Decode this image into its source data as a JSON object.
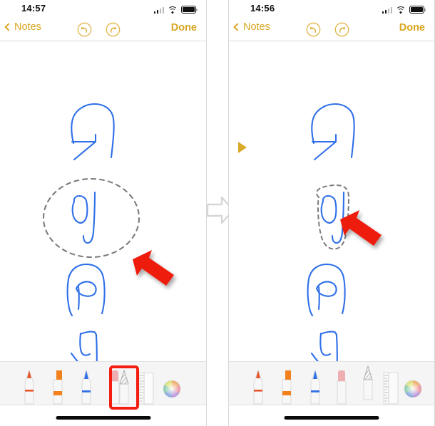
{
  "meta": {
    "app_name": "Notes",
    "screenshot_kind": "two-step-tutorial",
    "canvas_background": "#ffffff",
    "ink_color": "#2f6fe8",
    "accent_color": "#d9a520",
    "highlight_color": "#f41e10",
    "tray_background": "#f5f5f5"
  },
  "panels": [
    {
      "id": "before",
      "status_bar": {
        "time": "14:57",
        "icons": [
          "cellular-signal-icon",
          "wifi-icon",
          "battery-icon"
        ]
      },
      "nav_bar": {
        "back_label": "Notes",
        "back_icon": "chevron-left-icon",
        "undo_icon": "undo-circle-icon",
        "redo_icon": "redo-circle-icon",
        "done_label": "Done"
      },
      "canvas": {
        "selection": {
          "shape": "loose-circle",
          "style": "dashed",
          "color": "#808080",
          "label": "lasso-selection-loose"
        },
        "cursor": {
          "kind": "arrow-pointer",
          "color": "#ee1c11",
          "direction": "up-left"
        }
      },
      "toolbar": {
        "selected_tool": "lasso-tool",
        "selection_outline": true,
        "tools": [
          {
            "name": "pen-tool",
            "color": "#e8542a"
          },
          {
            "name": "highlighter-tool",
            "color": "#f2811d"
          },
          {
            "name": "pencil-tool",
            "color": "#2f6fe8"
          },
          {
            "name": "eraser-tool",
            "color": "#edafb1"
          },
          {
            "name": "lasso-tool",
            "color": "#9b9b9b"
          },
          {
            "name": "ruler-tool",
            "color": "#bdbdbd"
          }
        ],
        "color_picker": "color-wheel-icon"
      }
    },
    {
      "id": "after",
      "status_bar": {
        "time": "14:56",
        "icons": [
          "cellular-signal-icon",
          "wifi-icon",
          "battery-icon"
        ]
      },
      "nav_bar": {
        "back_label": "Notes",
        "back_icon": "chevron-left-icon",
        "undo_icon": "undo-circle-icon",
        "redo_icon": "redo-circle-icon",
        "done_label": "Done"
      },
      "canvas": {
        "selection": {
          "shape": "tight-outline",
          "style": "dashed",
          "color": "#808080",
          "label": "lasso-selection-tight"
        },
        "cursor": {
          "kind": "arrow-pointer",
          "color": "#ee1c11",
          "direction": "up-left"
        },
        "edge_marker": {
          "name": "selection-handle-marker",
          "color": "#d9a520",
          "shape": "triangle-right"
        }
      },
      "toolbar": {
        "selected_tool": "lasso-tool",
        "selection_outline": false,
        "tools": [
          {
            "name": "pen-tool",
            "color": "#e8542a"
          },
          {
            "name": "highlighter-tool",
            "color": "#f2811d"
          },
          {
            "name": "pencil-tool",
            "color": "#2f6fe8"
          },
          {
            "name": "eraser-tool",
            "color": "#edafb1"
          },
          {
            "name": "lasso-tool",
            "color": "#9b9b9b"
          },
          {
            "name": "ruler-tool",
            "color": "#bdbdbd"
          }
        ],
        "color_picker": "color-wheel-icon"
      }
    }
  ],
  "transition": {
    "icon": "right-arrow-icon",
    "color": "#d6d6d6"
  }
}
